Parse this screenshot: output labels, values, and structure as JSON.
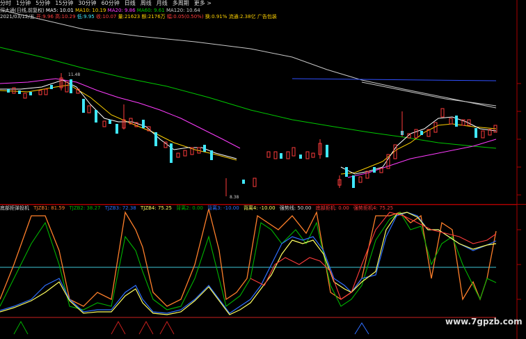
{
  "toolbar": {
    "items": [
      "分时",
      "1分钟",
      "5分钟",
      "15分钟",
      "30分钟",
      "60分钟",
      "日线",
      "周线",
      "月线",
      "多周期",
      "更多 >"
    ]
  },
  "colors": {
    "up": "#ff3c3c",
    "down": "#40e8ff",
    "ma5": "#ffffff",
    "ma10": "#ffd200",
    "ma20": "#ff3cff",
    "ma60": "#00c800",
    "ma120": "#c8c8c8",
    "blue": "#3050ff",
    "cyanline": "#40c8d8"
  },
  "info": {
    "stock": "深大通(日线,前复权)",
    "ma5": "MA5: 10.01",
    "ma10": "MA10: 10.19",
    "ma20": "MA20: 9.86",
    "ma60": "MA60: 9.61",
    "ma120": "MA120: 10.64",
    "date": "2021/03/12/五",
    "open": "开:9.96",
    "high": "高:10.29",
    "low": "低:9.95",
    "close": "收:10.07",
    "volume": "量:21623",
    "amount": "额:2176万",
    "change": "幅:0.05(0.50%)",
    "turnover": "换:0.91%",
    "circ": "流通:2.38亿",
    "tag": "广告包装"
  },
  "price_labels": {
    "high": "11.48",
    "low": "8.38"
  },
  "indicator": {
    "name": "底部拒弹投机",
    "tjzb1": "TJZB1: 81.59",
    "tjzb2": "TJZB2: 38.27",
    "tjzb3": "TJZB3: 72.38",
    "tjzb4": "TJZB4: 75.25",
    "b2": "背离2: 0.00",
    "b3": "背离3: -10.00",
    "b4": "背离4: -10.00",
    "strong": "强势线: 50.00",
    "bottom": "底部拒机: 0.00",
    "strongjump": "强势拒机4: 75.25"
  },
  "watermark": "www.7gpzb.com"
}
